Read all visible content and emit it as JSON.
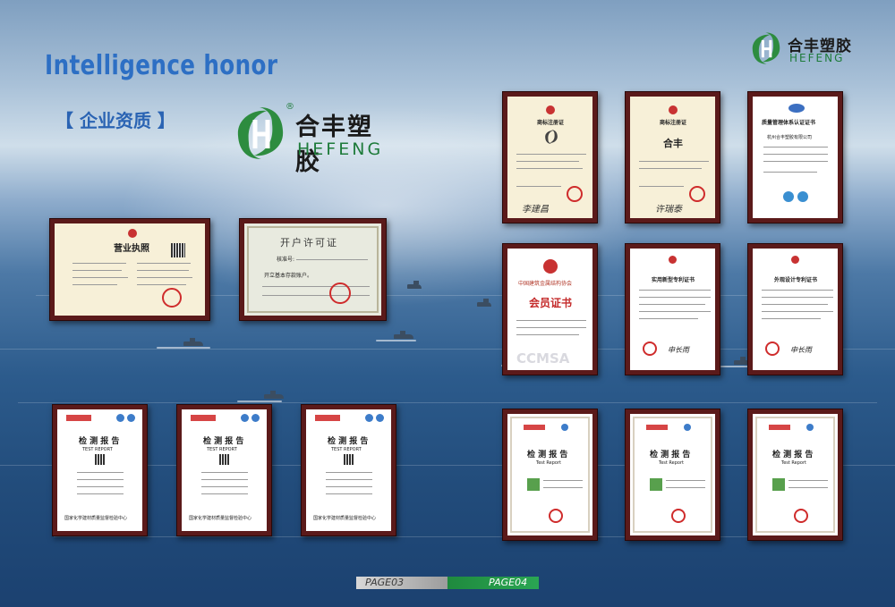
{
  "heading": {
    "title": "Intelligence honor",
    "subtitle": "【 企业资质 】"
  },
  "brand": {
    "name_cn": "合丰塑胶",
    "name_en": "HEFENG",
    "registered": "®",
    "colors": {
      "green": "#1e8a3c",
      "blue_title": "#2d6fc4"
    }
  },
  "certificates": {
    "business_license": {
      "title": "营业执照"
    },
    "account_permit": {
      "title": "开户许可证",
      "lines": [
        "核准号:",
        "开立基本存款账户。"
      ]
    },
    "trademark_1": {
      "title": "商标注册证",
      "signature": "李建昌"
    },
    "trademark_2": {
      "title": "商标注册证",
      "mark": "合丰",
      "signature": "许瑞泰"
    },
    "quality_cert": {
      "title": "质量管理体系认证证书",
      "company": "杭州合丰塑胶有限公司"
    },
    "membership": {
      "org": "中国建筑金属结构协会",
      "title": "会员证书",
      "watermark": "CCMSA"
    },
    "utility_patent": {
      "title": "实用新型专利证书",
      "signature": "申长雨"
    },
    "design_patent": {
      "title": "外观设计专利证书",
      "signature": "申长雨"
    },
    "test_reports_left": [
      {
        "title": "检 测 报 告",
        "en": "TEST REPORT",
        "footer": "国家化学建材质量监督检验中心"
      },
      {
        "title": "检 测 报 告",
        "en": "TEST REPORT",
        "footer": "国家化学建材质量监督检验中心"
      },
      {
        "title": "检 测 报 告",
        "en": "TEST REPORT",
        "footer": "国家化学建材质量监督检验中心"
      }
    ],
    "test_reports_right": [
      {
        "title": "检 测 报 告",
        "en": "Test Report"
      },
      {
        "title": "检 测 报 告",
        "en": "Test Report"
      },
      {
        "title": "检 测 报 告",
        "en": "Test Report"
      }
    ]
  },
  "footer": {
    "page_left": "PAGE03",
    "page_right": "PAGE04"
  }
}
